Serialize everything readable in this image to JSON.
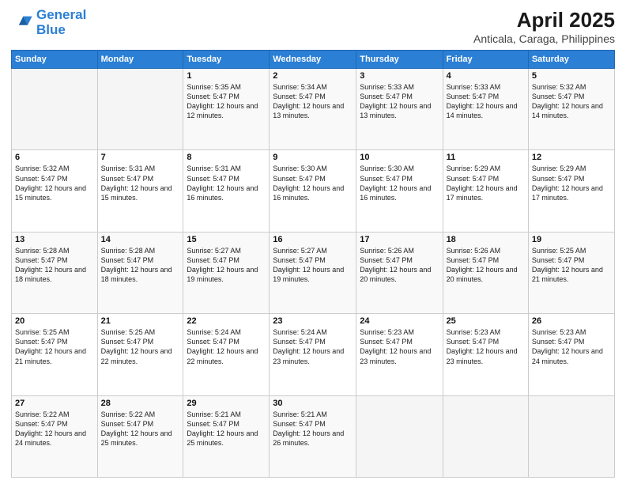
{
  "logo": {
    "line1": "General",
    "line2": "Blue"
  },
  "title": "April 2025",
  "subtitle": "Anticala, Caraga, Philippines",
  "weekdays": [
    "Sunday",
    "Monday",
    "Tuesday",
    "Wednesday",
    "Thursday",
    "Friday",
    "Saturday"
  ],
  "weeks": [
    [
      {
        "day": "",
        "sunrise": "",
        "sunset": "",
        "daylight": ""
      },
      {
        "day": "",
        "sunrise": "",
        "sunset": "",
        "daylight": ""
      },
      {
        "day": "1",
        "sunrise": "Sunrise: 5:35 AM",
        "sunset": "Sunset: 5:47 PM",
        "daylight": "Daylight: 12 hours and 12 minutes."
      },
      {
        "day": "2",
        "sunrise": "Sunrise: 5:34 AM",
        "sunset": "Sunset: 5:47 PM",
        "daylight": "Daylight: 12 hours and 13 minutes."
      },
      {
        "day": "3",
        "sunrise": "Sunrise: 5:33 AM",
        "sunset": "Sunset: 5:47 PM",
        "daylight": "Daylight: 12 hours and 13 minutes."
      },
      {
        "day": "4",
        "sunrise": "Sunrise: 5:33 AM",
        "sunset": "Sunset: 5:47 PM",
        "daylight": "Daylight: 12 hours and 14 minutes."
      },
      {
        "day": "5",
        "sunrise": "Sunrise: 5:32 AM",
        "sunset": "Sunset: 5:47 PM",
        "daylight": "Daylight: 12 hours and 14 minutes."
      }
    ],
    [
      {
        "day": "6",
        "sunrise": "Sunrise: 5:32 AM",
        "sunset": "Sunset: 5:47 PM",
        "daylight": "Daylight: 12 hours and 15 minutes."
      },
      {
        "day": "7",
        "sunrise": "Sunrise: 5:31 AM",
        "sunset": "Sunset: 5:47 PM",
        "daylight": "Daylight: 12 hours and 15 minutes."
      },
      {
        "day": "8",
        "sunrise": "Sunrise: 5:31 AM",
        "sunset": "Sunset: 5:47 PM",
        "daylight": "Daylight: 12 hours and 16 minutes."
      },
      {
        "day": "9",
        "sunrise": "Sunrise: 5:30 AM",
        "sunset": "Sunset: 5:47 PM",
        "daylight": "Daylight: 12 hours and 16 minutes."
      },
      {
        "day": "10",
        "sunrise": "Sunrise: 5:30 AM",
        "sunset": "Sunset: 5:47 PM",
        "daylight": "Daylight: 12 hours and 16 minutes."
      },
      {
        "day": "11",
        "sunrise": "Sunrise: 5:29 AM",
        "sunset": "Sunset: 5:47 PM",
        "daylight": "Daylight: 12 hours and 17 minutes."
      },
      {
        "day": "12",
        "sunrise": "Sunrise: 5:29 AM",
        "sunset": "Sunset: 5:47 PM",
        "daylight": "Daylight: 12 hours and 17 minutes."
      }
    ],
    [
      {
        "day": "13",
        "sunrise": "Sunrise: 5:28 AM",
        "sunset": "Sunset: 5:47 PM",
        "daylight": "Daylight: 12 hours and 18 minutes."
      },
      {
        "day": "14",
        "sunrise": "Sunrise: 5:28 AM",
        "sunset": "Sunset: 5:47 PM",
        "daylight": "Daylight: 12 hours and 18 minutes."
      },
      {
        "day": "15",
        "sunrise": "Sunrise: 5:27 AM",
        "sunset": "Sunset: 5:47 PM",
        "daylight": "Daylight: 12 hours and 19 minutes."
      },
      {
        "day": "16",
        "sunrise": "Sunrise: 5:27 AM",
        "sunset": "Sunset: 5:47 PM",
        "daylight": "Daylight: 12 hours and 19 minutes."
      },
      {
        "day": "17",
        "sunrise": "Sunrise: 5:26 AM",
        "sunset": "Sunset: 5:47 PM",
        "daylight": "Daylight: 12 hours and 20 minutes."
      },
      {
        "day": "18",
        "sunrise": "Sunrise: 5:26 AM",
        "sunset": "Sunset: 5:47 PM",
        "daylight": "Daylight: 12 hours and 20 minutes."
      },
      {
        "day": "19",
        "sunrise": "Sunrise: 5:25 AM",
        "sunset": "Sunset: 5:47 PM",
        "daylight": "Daylight: 12 hours and 21 minutes."
      }
    ],
    [
      {
        "day": "20",
        "sunrise": "Sunrise: 5:25 AM",
        "sunset": "Sunset: 5:47 PM",
        "daylight": "Daylight: 12 hours and 21 minutes."
      },
      {
        "day": "21",
        "sunrise": "Sunrise: 5:25 AM",
        "sunset": "Sunset: 5:47 PM",
        "daylight": "Daylight: 12 hours and 22 minutes."
      },
      {
        "day": "22",
        "sunrise": "Sunrise: 5:24 AM",
        "sunset": "Sunset: 5:47 PM",
        "daylight": "Daylight: 12 hours and 22 minutes."
      },
      {
        "day": "23",
        "sunrise": "Sunrise: 5:24 AM",
        "sunset": "Sunset: 5:47 PM",
        "daylight": "Daylight: 12 hours and 23 minutes."
      },
      {
        "day": "24",
        "sunrise": "Sunrise: 5:23 AM",
        "sunset": "Sunset: 5:47 PM",
        "daylight": "Daylight: 12 hours and 23 minutes."
      },
      {
        "day": "25",
        "sunrise": "Sunrise: 5:23 AM",
        "sunset": "Sunset: 5:47 PM",
        "daylight": "Daylight: 12 hours and 23 minutes."
      },
      {
        "day": "26",
        "sunrise": "Sunrise: 5:23 AM",
        "sunset": "Sunset: 5:47 PM",
        "daylight": "Daylight: 12 hours and 24 minutes."
      }
    ],
    [
      {
        "day": "27",
        "sunrise": "Sunrise: 5:22 AM",
        "sunset": "Sunset: 5:47 PM",
        "daylight": "Daylight: 12 hours and 24 minutes."
      },
      {
        "day": "28",
        "sunrise": "Sunrise: 5:22 AM",
        "sunset": "Sunset: 5:47 PM",
        "daylight": "Daylight: 12 hours and 25 minutes."
      },
      {
        "day": "29",
        "sunrise": "Sunrise: 5:21 AM",
        "sunset": "Sunset: 5:47 PM",
        "daylight": "Daylight: 12 hours and 25 minutes."
      },
      {
        "day": "30",
        "sunrise": "Sunrise: 5:21 AM",
        "sunset": "Sunset: 5:47 PM",
        "daylight": "Daylight: 12 hours and 26 minutes."
      },
      {
        "day": "",
        "sunrise": "",
        "sunset": "",
        "daylight": ""
      },
      {
        "day": "",
        "sunrise": "",
        "sunset": "",
        "daylight": ""
      },
      {
        "day": "",
        "sunrise": "",
        "sunset": "",
        "daylight": ""
      }
    ]
  ]
}
